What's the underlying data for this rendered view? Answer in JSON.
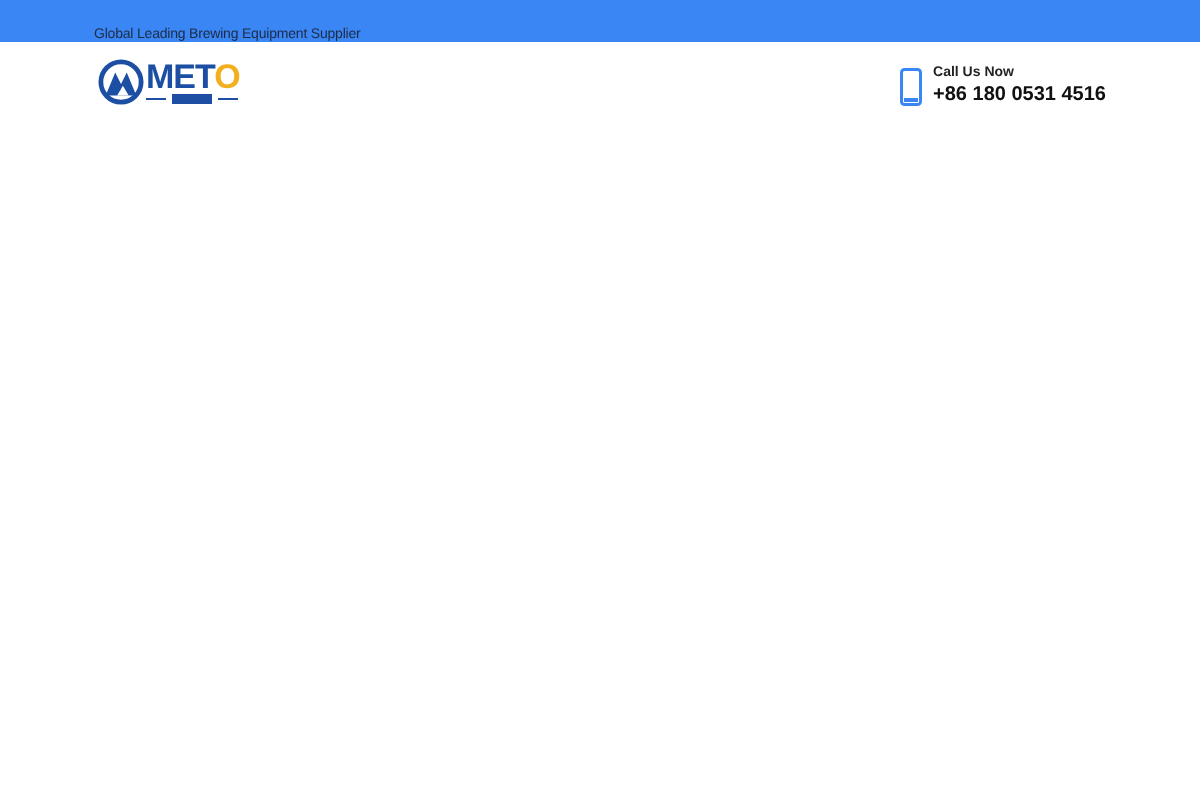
{
  "top_bar": {
    "tagline": "Global Leading Brewing Equipment Supplier"
  },
  "header": {
    "logo": {
      "text": "METO"
    },
    "contact": {
      "label": "Call Us Now",
      "phone": "+86 180 0531 4516"
    }
  }
}
